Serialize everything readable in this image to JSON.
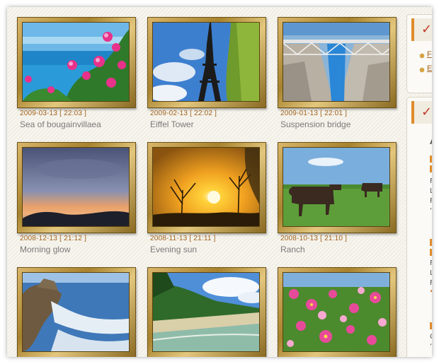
{
  "gallery": {
    "items": [
      {
        "date": "2009-03-13 [ 22:03 ]",
        "title": "Sea of bougainvillaea",
        "scene": "sea-flowers"
      },
      {
        "date": "2009-02-13 [ 22:02 ]",
        "title": "Eiffel Tower",
        "scene": "eiffel"
      },
      {
        "date": "2009-01-13 [ 22:01 ]",
        "title": "Suspension bridge",
        "scene": "bridge"
      },
      {
        "date": "2008-12-13 [ 21:12 ]",
        "title": "Morning glow",
        "scene": "glow"
      },
      {
        "date": "2008-11-13 [ 21:11 ]",
        "title": "Evening sun",
        "scene": "sunset"
      },
      {
        "date": "2008-10-13 [ 21:10 ]",
        "title": "Ranch",
        "scene": "ranch"
      },
      {
        "date": "",
        "title": "",
        "scene": "coast"
      },
      {
        "date": "",
        "title": "",
        "scene": "beach"
      },
      {
        "date": "",
        "title": "",
        "scene": "cosmos"
      }
    ]
  },
  "sidebar": {
    "box1": {
      "links": [
        "F",
        "E"
      ]
    },
    "box2": {
      "letters": [
        "A",
        "I",
        "I",
        "F",
        "L",
        "F",
        "‘",
        "I",
        "I",
        "F",
        "L",
        "F",
        "‘",
        "I",
        "C",
        "‘"
      ]
    }
  },
  "colors": {
    "accent": "#e08b2c",
    "date": "#a0621c",
    "caption": "#7a7a7a",
    "check": "#c0392b"
  }
}
